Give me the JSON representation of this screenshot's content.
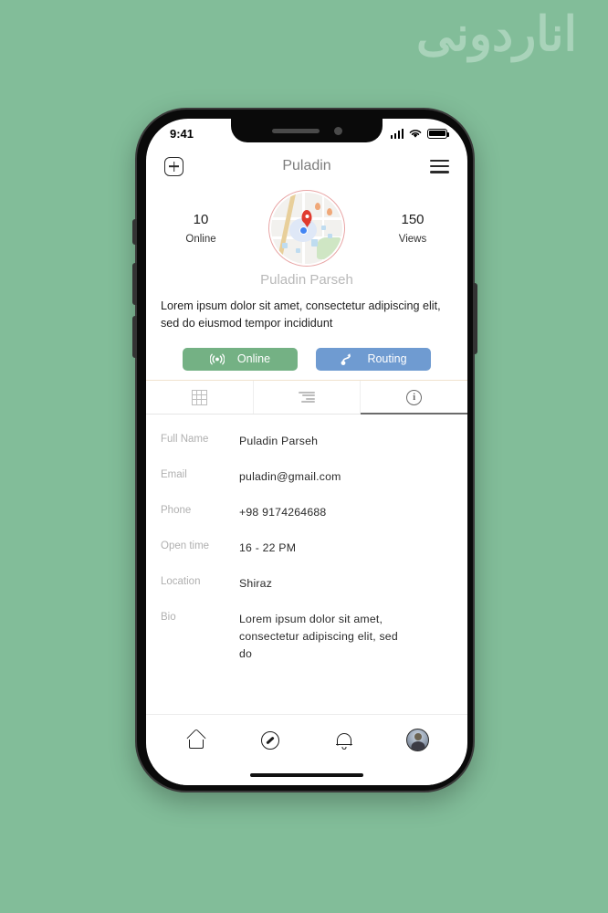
{
  "watermark": {
    "text": "اناردونی"
  },
  "status_bar": {
    "time": "9:41",
    "signal_icon": "cellular-bars-icon",
    "wifi_icon": "wifi-icon",
    "battery_icon": "battery-full-icon"
  },
  "app_header": {
    "add_icon": "plus-square-icon",
    "title": "Puladin",
    "menu_icon": "hamburger-menu-icon"
  },
  "profile": {
    "stat_left": {
      "value": "10",
      "label": "Online"
    },
    "stat_right": {
      "value": "150",
      "label": "Views"
    },
    "avatar_icon": "map-thumbnail-avatar",
    "name": "Puladin Parseh",
    "description": "Lorem ipsum dolor sit amet, consectetur adipiscing elit, sed do eiusmod tempor incididunt"
  },
  "actions": {
    "online": {
      "label": "Online",
      "icon": "broadcast-icon",
      "color": "#74b184"
    },
    "routing": {
      "label": "Routing",
      "icon": "route-icon",
      "color": "#6f9bd1"
    }
  },
  "tabs": [
    {
      "name": "grid",
      "icon": "grid-icon",
      "active": false
    },
    {
      "name": "list",
      "icon": "list-lines-icon",
      "active": false
    },
    {
      "name": "info",
      "icon": "info-circle-icon",
      "active": true,
      "glyph": "i"
    }
  ],
  "details": [
    {
      "key": "Full Name",
      "value": "Puladin Parseh"
    },
    {
      "key": "Email",
      "value": "puladin@gmail.com"
    },
    {
      "key": "Phone",
      "value": "+98 9174264688"
    },
    {
      "key": "Open time",
      "value": "16 - 22 PM"
    },
    {
      "key": "Location",
      "value": "Shiraz"
    },
    {
      "key": "Bio",
      "value": "Lorem ipsum dolor sit amet, consectetur adipiscing elit, sed do"
    }
  ],
  "bottom_nav": [
    {
      "name": "home",
      "icon": "home-icon"
    },
    {
      "name": "explore",
      "icon": "compass-icon"
    },
    {
      "name": "notifications",
      "icon": "bell-icon"
    },
    {
      "name": "profile",
      "icon": "user-avatar-icon"
    }
  ],
  "theme": {
    "background": "#82bd99",
    "watermark_color": "#a9d3ba",
    "accent_green": "#74b184",
    "accent_blue": "#6f9bd1"
  }
}
